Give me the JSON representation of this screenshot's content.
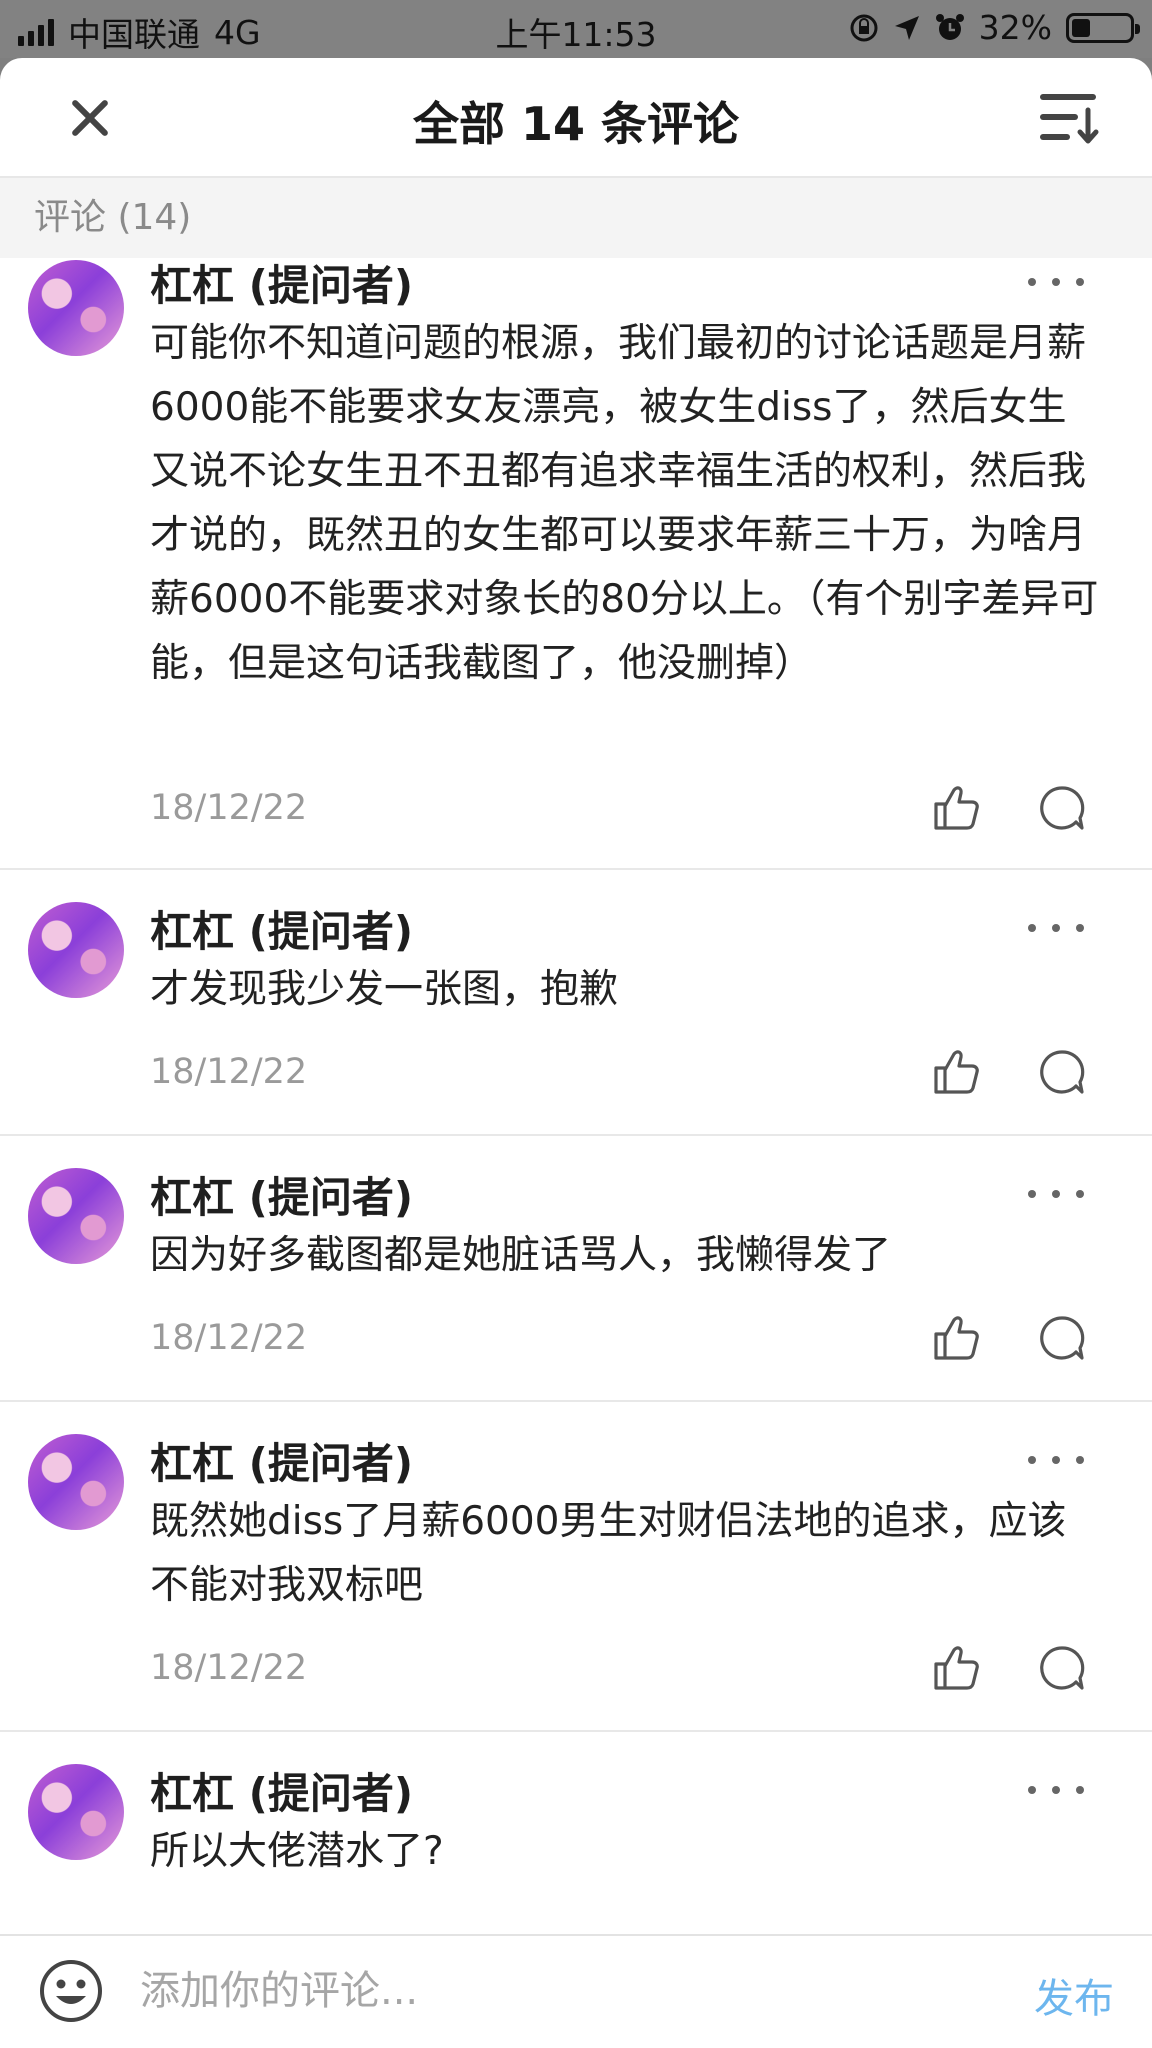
{
  "status_bar": {
    "carrier": "中国联通",
    "network": "4G",
    "time": "上午11:53",
    "battery_percent": "32%",
    "battery_level": 0.32
  },
  "header": {
    "title": "全部 14 条评论",
    "close_icon": "close-icon",
    "sort_icon": "sort-icon"
  },
  "section": {
    "label": "评论 (14)"
  },
  "comments": [
    {
      "author": "杠杠 (提问者)",
      "text": "可能你不知道问题的根源，我们最初的讨论话题是月薪6000能不能要求女友漂亮，被女生diss了，然后女生又说不论女生丑不丑都有追求幸福生活的权利，然后我才说的，既然丑的女生都可以要求年薪三十万，为啥月薪6000不能要求对象长的80分以上。（有个别字差异可能，但是这句话我截图了，他没删掉）",
      "date": "18/12/22"
    },
    {
      "author": "杠杠 (提问者)",
      "text": "才发现我少发一张图，抱歉",
      "date": "18/12/22"
    },
    {
      "author": "杠杠 (提问者)",
      "text": "因为好多截图都是她脏话骂人，我懒得发了",
      "date": "18/12/22"
    },
    {
      "author": "杠杠 (提问者)",
      "text": "既然她diss了月薪6000男生对财侣法地的追求，应该不能对我双标吧",
      "date": "18/12/22"
    },
    {
      "author": "杠杠 (提问者)",
      "text": "所以大佬潜水了?",
      "date": ""
    }
  ],
  "input_bar": {
    "placeholder": "添加你的评论...",
    "publish_label": "发布",
    "publish_color": "#6db6ee"
  }
}
